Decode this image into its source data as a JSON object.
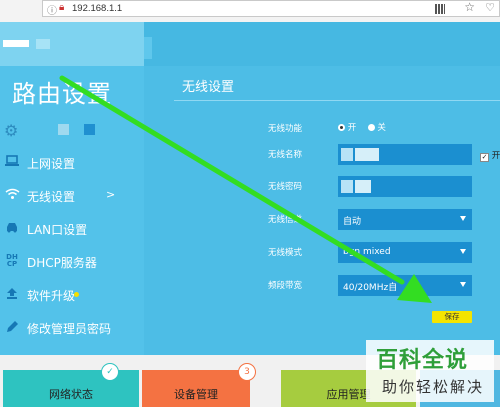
{
  "browser": {
    "url": "192.168.1.1",
    "icons": [
      "info-icon",
      "insecure-lock-icon",
      "qr-code-icon",
      "star-icon",
      "heart-icon"
    ]
  },
  "sidebar": {
    "title": "路由设置",
    "items": [
      {
        "label": "上网设置",
        "icon": "computer-icon"
      },
      {
        "label": "无线设置",
        "icon": "wifi-icon",
        "arrow": ">"
      },
      {
        "label": "LAN口设置",
        "icon": "car-icon"
      },
      {
        "label": "DHCP服务器",
        "icon": "dhcp-icon",
        "icon_text": "DH CP"
      },
      {
        "label": "软件升级",
        "icon": "upload-icon"
      },
      {
        "label": "修改管理员密码",
        "icon": "pencil-icon"
      }
    ]
  },
  "main": {
    "section_title": "无线设置",
    "rows": [
      {
        "label": "无线功能",
        "radio_on": "开",
        "radio_off": "关"
      },
      {
        "label": "无线名称",
        "checkbox_label": "开"
      },
      {
        "label": "无线密码"
      },
      {
        "label": "无线信道",
        "value": "自动"
      },
      {
        "label": "无线模式",
        "value": "bgn mixed"
      },
      {
        "label": "频段带宽",
        "value": "40/20MHz自"
      }
    ],
    "save_label": "保存"
  },
  "bottom_nav": [
    {
      "label": "网络状态",
      "badge": "✓"
    },
    {
      "label": "设备管理",
      "badge": "3"
    },
    {
      "label": "应用管理"
    }
  ],
  "watermark": {
    "main": "百科全说",
    "sub": "助你轻松解决"
  },
  "colors": {
    "app_bg": "#4dbde6",
    "field_bg": "#1b8fd0",
    "save_button": "#f4e400",
    "tile_network": "#2ec3c0",
    "tile_devices": "#f47242",
    "tile_apps": "#a6cc3f",
    "annotation_arrow": "#33dd22"
  }
}
